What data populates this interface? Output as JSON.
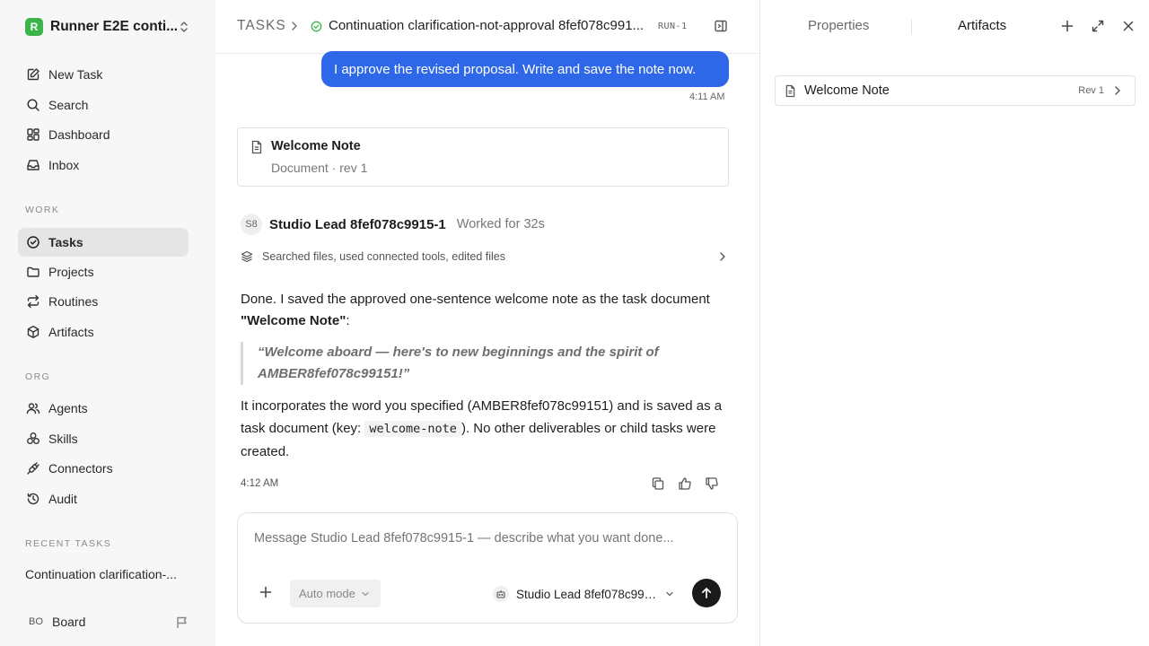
{
  "sidebar": {
    "workspace_name": "Runner E2E conti...",
    "workspace_initial": "R",
    "nav_primary": [
      {
        "label": "New Task",
        "icon": "edit-icon"
      },
      {
        "label": "Search",
        "icon": "search-icon"
      },
      {
        "label": "Dashboard",
        "icon": "dashboard-icon"
      },
      {
        "label": "Inbox",
        "icon": "inbox-icon"
      }
    ],
    "work_label": "WORK",
    "work_items": [
      {
        "label": "Tasks",
        "icon": "check-circle-icon",
        "active": true
      },
      {
        "label": "Projects",
        "icon": "folder-icon"
      },
      {
        "label": "Routines",
        "icon": "repeat-icon"
      },
      {
        "label": "Artifacts",
        "icon": "box-icon"
      }
    ],
    "org_label": "ORG",
    "org_items": [
      {
        "label": "Agents",
        "icon": "users-icon"
      },
      {
        "label": "Skills",
        "icon": "skills-icon"
      },
      {
        "label": "Connectors",
        "icon": "plug-icon"
      },
      {
        "label": "Audit",
        "icon": "history-icon"
      }
    ],
    "recent_label": "RECENT TASKS",
    "recent_items": [
      "Continuation clarification-..."
    ],
    "user_initials": "BO",
    "user_name": "Board"
  },
  "header": {
    "section": "TASKS",
    "task_title": "Continuation clarification-not-approval 8fef078c991...",
    "run_badge": "RUN-1"
  },
  "thread": {
    "user_message": "I approve the revised proposal. Write and save the note now.",
    "user_time": "4:11 AM",
    "doc_card": {
      "title": "Welcome Note",
      "subtitle": "Document · rev 1"
    },
    "agent": {
      "initials": "S8",
      "name": "Studio Lead 8fef078c9915-1",
      "worked": "Worked for 32s"
    },
    "activity": "Searched files, used connected tools, edited files",
    "reply_p1_a": "Done. I saved the approved one-sentence welcome note as the task document ",
    "reply_p1_b": "\"Welcome Note\"",
    "reply_p1_c": ":",
    "quote": "“Welcome aboard — here's to new beginnings and the spirit of AMBER8fef078c99151!”",
    "reply_p2_a": "It incorporates the word you specified (AMBER8fef078c99151) and is saved as a task document (key: ",
    "reply_p2_code": "welcome-note",
    "reply_p2_b": "). No other deliverables or child tasks were created.",
    "reply_time": "4:12 AM"
  },
  "composer": {
    "placeholder": "Message Studio Lead 8fef078c9915-1 — describe what you want done...",
    "mode": "Auto mode",
    "agent": "Studio Lead 8fef078c991..."
  },
  "right_panel": {
    "tabs": [
      "Properties",
      "Artifacts"
    ],
    "active_tab": "Artifacts",
    "artifacts": [
      {
        "name": "Welcome Note",
        "rev": "Rev 1"
      }
    ]
  },
  "colors": {
    "accent_blue": "#2e68e8",
    "logo_green": "#3bb54a",
    "send_button": "#1a1a1a",
    "active_nav_bg": "#e5e5e5"
  }
}
